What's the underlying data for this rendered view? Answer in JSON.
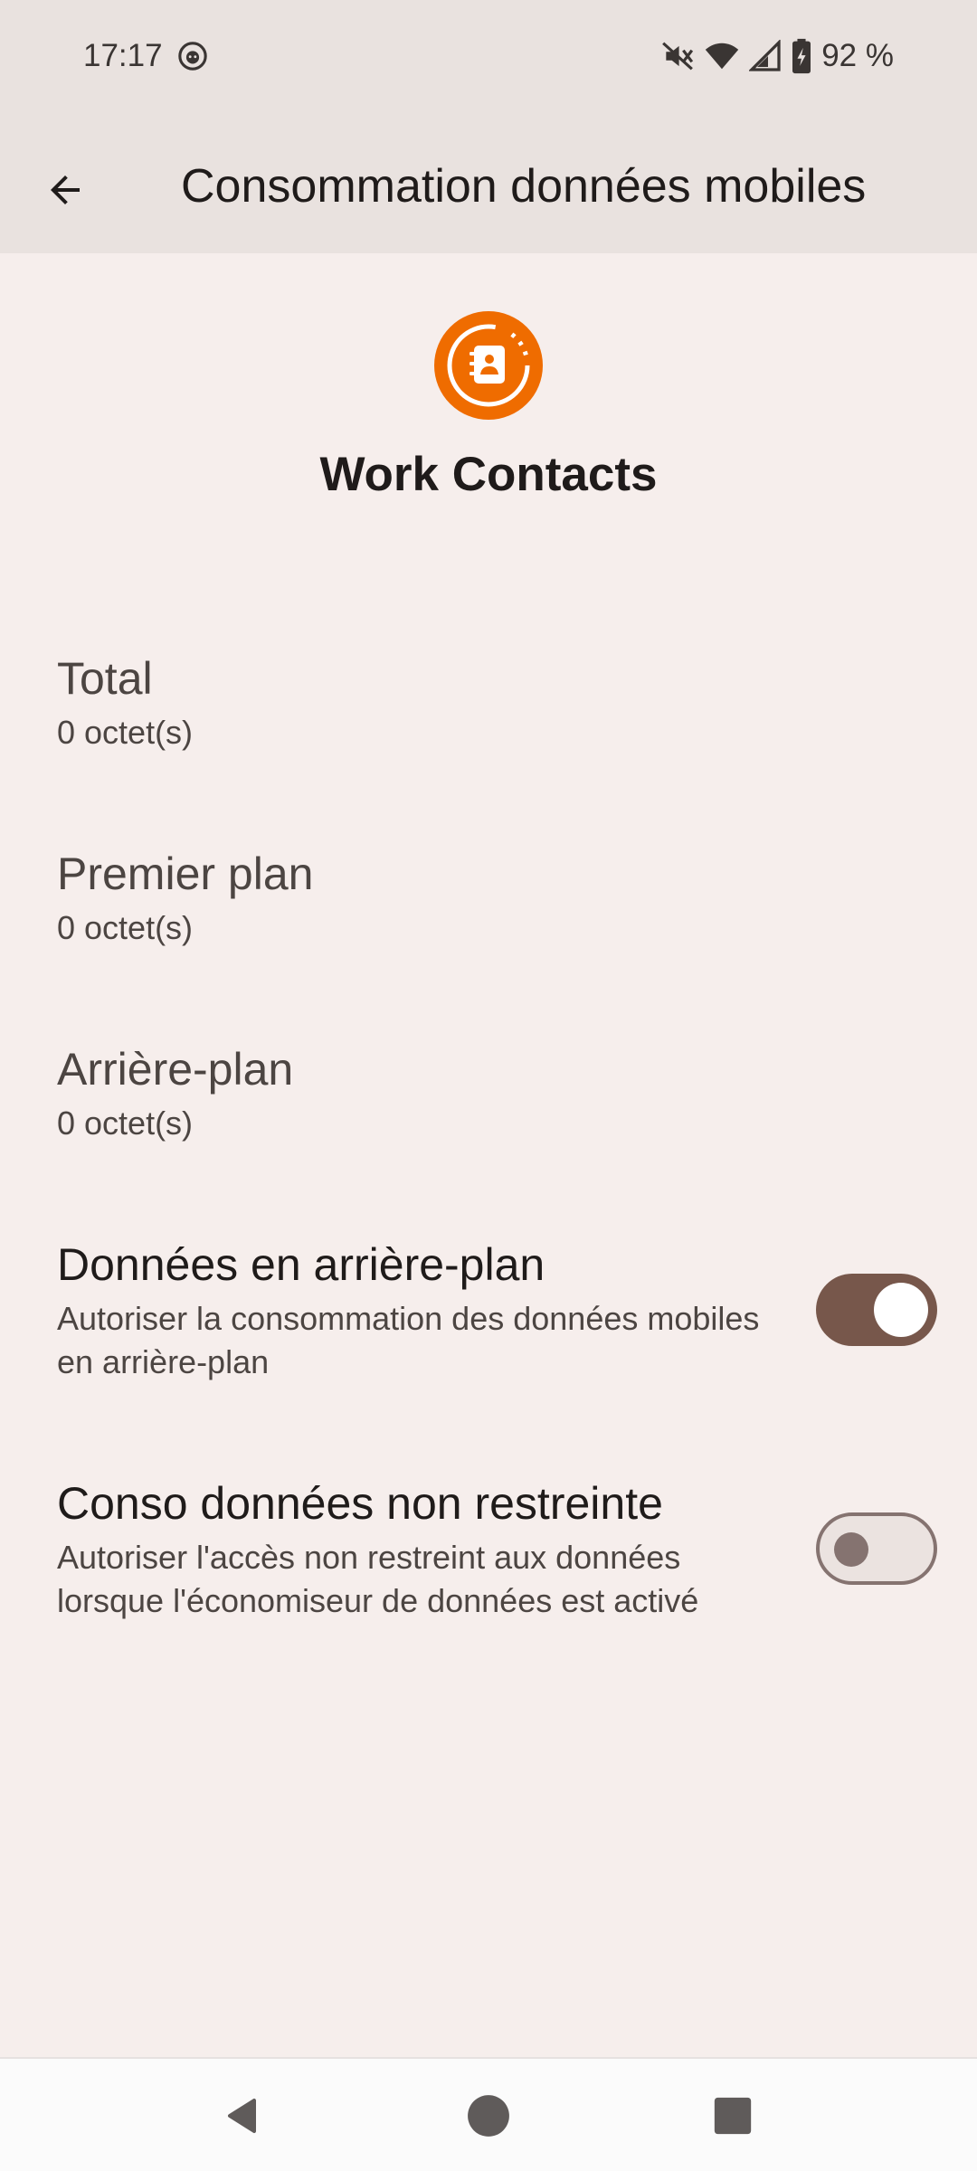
{
  "status_bar": {
    "time": "17:17",
    "battery_text": "92 %",
    "icons": [
      "alert-face-icon",
      "mute-icon",
      "wifi-icon",
      "signal-icon",
      "battery-charging-icon"
    ]
  },
  "app_bar": {
    "title": "Consommation données mobiles",
    "back_icon": "arrow-back-icon"
  },
  "app": {
    "name": "Work Contacts",
    "icon": "contacts-book-icon",
    "icon_color": "#ef6c00"
  },
  "usage": [
    {
      "title": "Total",
      "value": "0 octet(s)"
    },
    {
      "title": "Premier plan",
      "value": "0 octet(s)"
    },
    {
      "title": "Arrière-plan",
      "value": "0 octet(s)"
    }
  ],
  "toggles": [
    {
      "title": "Données en arrière-plan",
      "summary": "Autoriser la consommation des données mobiles en arrière-plan",
      "checked": true
    },
    {
      "title": "Conso données non restreinte",
      "summary": "Autoriser l'accès non restreint aux données lorsque l'économiseur de données est activé",
      "checked": false
    }
  ],
  "colors": {
    "background": "#f6eeec",
    "app_bar": "#e9e2df",
    "switch_on_track": "#77574b",
    "switch_off_border": "#857370"
  },
  "nav_bar": {
    "icons": [
      "back-triangle-icon",
      "home-circle-icon",
      "recents-square-icon"
    ]
  }
}
